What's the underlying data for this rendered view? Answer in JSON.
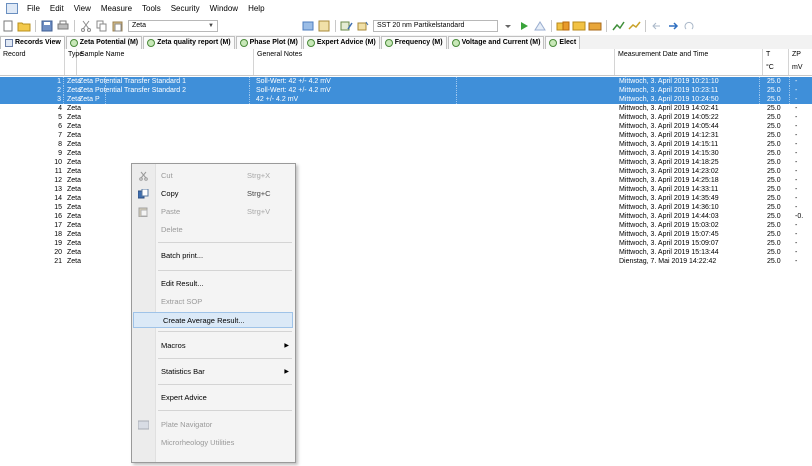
{
  "menubar": {
    "items": [
      "File",
      "Edit",
      "View",
      "Measure",
      "Tools",
      "Security",
      "Window",
      "Help"
    ]
  },
  "toolbar": {
    "combo1_value": "Zeta",
    "combo2_value": "SST 20 nm Partikelstandard"
  },
  "tabs": [
    {
      "label": "Records View",
      "icon": "grid-icon"
    },
    {
      "label": "Zeta Potential (M)",
      "icon": "zeta-icon"
    },
    {
      "label": "Zeta quality report (M)",
      "icon": "zeta-icon"
    },
    {
      "label": "Phase Plot (M)",
      "icon": "zeta-icon"
    },
    {
      "label": "Expert Advice (M)",
      "icon": "zeta-icon"
    },
    {
      "label": "Frequency (M)",
      "icon": "zeta-icon"
    },
    {
      "label": "Voltage and Current (M)",
      "icon": "zeta-icon"
    },
    {
      "label": "Elect",
      "icon": "zeta-icon"
    }
  ],
  "table": {
    "headers": {
      "record": "Record",
      "type": "Type",
      "sample_name": "Sample Name",
      "general_notes": "General Notes",
      "date": "Measurement Date and Time",
      "t": "T",
      "t_unit": "°C",
      "zp": "ZP",
      "zp_unit": "mV"
    },
    "rows": [
      {
        "record": "1",
        "type": "Zeta",
        "name": "Zeta Potential Transfer Standard 1",
        "notes": "Soll-Wert: 42 +/- 4.2 mV",
        "date": "Mittwoch, 3. April 2019 10:21:10",
        "t": "25.0",
        "zp": "-",
        "selected": true
      },
      {
        "record": "2",
        "type": "Zeta",
        "name": "Zeta Potential Transfer Standard 2",
        "notes": "Soll-Wert: 42 +/- 4.2 mV",
        "date": "Mittwoch, 3. April 2019 10:23:11",
        "t": "25.0",
        "zp": "-",
        "selected": true
      },
      {
        "record": "3",
        "type": "Zeta",
        "name": "Zeta P",
        "notes": "42 +/- 4.2 mV",
        "date": "Mittwoch, 3. April 2019 10:24:50",
        "t": "25.0",
        "zp": "-",
        "selected": true
      },
      {
        "record": "4",
        "type": "Zeta",
        "name": "",
        "notes": "",
        "date": "Mittwoch, 3. April 2019 14:02:41",
        "t": "25.0",
        "zp": "-"
      },
      {
        "record": "5",
        "type": "Zeta",
        "name": "",
        "notes": "",
        "date": "Mittwoch, 3. April 2019 14:05:22",
        "t": "25.0",
        "zp": "-"
      },
      {
        "record": "6",
        "type": "Zeta",
        "name": "",
        "notes": "",
        "date": "Mittwoch, 3. April 2019 14:05:44",
        "t": "25.0",
        "zp": "-"
      },
      {
        "record": "7",
        "type": "Zeta",
        "name": "",
        "notes": "",
        "date": "Mittwoch, 3. April 2019 14:12:31",
        "t": "25.0",
        "zp": "-"
      },
      {
        "record": "8",
        "type": "Zeta",
        "name": "",
        "notes": "",
        "date": "Mittwoch, 3. April 2019 14:15:11",
        "t": "25.0",
        "zp": "-"
      },
      {
        "record": "9",
        "type": "Zeta",
        "name": "",
        "notes": "",
        "date": "Mittwoch, 3. April 2019 14:15:30",
        "t": "25.0",
        "zp": "-"
      },
      {
        "record": "10",
        "type": "Zeta",
        "name": "",
        "notes": "",
        "date": "Mittwoch, 3. April 2019 14:18:25",
        "t": "25.0",
        "zp": "-"
      },
      {
        "record": "11",
        "type": "Zeta",
        "name": "",
        "notes": "",
        "date": "Mittwoch, 3. April 2019 14:23:02",
        "t": "25.0",
        "zp": "-"
      },
      {
        "record": "12",
        "type": "Zeta",
        "name": "",
        "notes": "",
        "date": "Mittwoch, 3. April 2019 14:25:18",
        "t": "25.0",
        "zp": "-"
      },
      {
        "record": "13",
        "type": "Zeta",
        "name": "",
        "notes": "",
        "date": "Mittwoch, 3. April 2019 14:33:11",
        "t": "25.0",
        "zp": "-"
      },
      {
        "record": "14",
        "type": "Zeta",
        "name": "",
        "notes": "",
        "date": "Mittwoch, 3. April 2019 14:35:49",
        "t": "25.0",
        "zp": "-"
      },
      {
        "record": "15",
        "type": "Zeta",
        "name": "",
        "notes": "",
        "date": "Mittwoch, 3. April 2019 14:36:10",
        "t": "25.0",
        "zp": "-"
      },
      {
        "record": "16",
        "type": "Zeta",
        "name": "",
        "notes": "",
        "date": "Mittwoch, 3. April 2019 14:44:03",
        "t": "25.0",
        "zp": "-0."
      },
      {
        "record": "17",
        "type": "Zeta",
        "name": "",
        "notes": "",
        "date": "Mittwoch, 3. April 2019 15:03:02",
        "t": "25.0",
        "zp": "-"
      },
      {
        "record": "18",
        "type": "Zeta",
        "name": "",
        "notes": "",
        "date": "Mittwoch, 3. April 2019 15:07:45",
        "t": "25.0",
        "zp": "-"
      },
      {
        "record": "19",
        "type": "Zeta",
        "name": "",
        "notes": "",
        "date": "Mittwoch, 3. April 2019 15:09:07",
        "t": "25.0",
        "zp": "-"
      },
      {
        "record": "20",
        "type": "Zeta",
        "name": "",
        "notes": "",
        "date": "Mittwoch, 3. April 2019 15:13:44",
        "t": "25.0",
        "zp": "-"
      },
      {
        "record": "21",
        "type": "Zeta",
        "name": "",
        "notes": "",
        "date": "Dienstag, 7. Mai 2019 14:22:42",
        "t": "25.0",
        "zp": "-"
      }
    ]
  },
  "context_menu": {
    "items": [
      {
        "label": "Cut",
        "shortcut": "Strg+X",
        "disabled": true,
        "icon": "cut-icon"
      },
      {
        "label": "Copy",
        "shortcut": "Strg+C",
        "disabled": false,
        "icon": "copy-icon"
      },
      {
        "label": "Paste",
        "shortcut": "Strg+V",
        "disabled": true,
        "icon": "paste-icon"
      },
      {
        "label": "Delete",
        "shortcut": "",
        "disabled": true,
        "icon": ""
      },
      {
        "label": "Batch print...",
        "shortcut": "",
        "disabled": false,
        "icon": ""
      },
      {
        "label": "Edit Result...",
        "shortcut": "",
        "disabled": false,
        "icon": ""
      },
      {
        "label": "Extract SOP",
        "shortcut": "",
        "disabled": true,
        "icon": ""
      },
      {
        "label": "Create Average Result...",
        "shortcut": "",
        "disabled": false,
        "hover": true,
        "icon": ""
      },
      {
        "label": "Macros",
        "shortcut": "",
        "disabled": false,
        "submenu": true,
        "icon": ""
      },
      {
        "label": "Statistics Bar",
        "shortcut": "",
        "disabled": false,
        "submenu": true,
        "icon": ""
      },
      {
        "label": "Expert Advice",
        "shortcut": "",
        "disabled": false,
        "icon": ""
      },
      {
        "label": "Plate Navigator",
        "shortcut": "",
        "disabled": true,
        "icon": "plate-icon"
      },
      {
        "label": "Microrheology Utilities",
        "shortcut": "",
        "disabled": true,
        "icon": ""
      }
    ]
  },
  "colors": {
    "selection": "#3f8fd9",
    "menu_hover": "#dbe9f7"
  }
}
